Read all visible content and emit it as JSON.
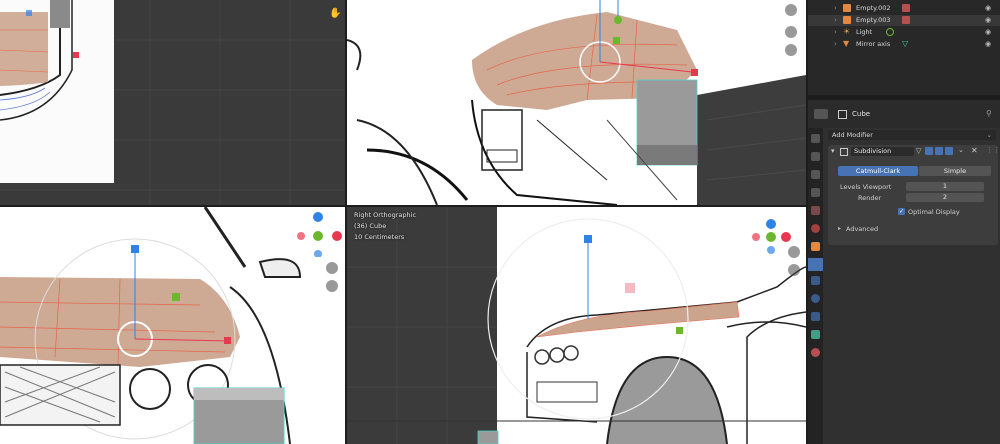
{
  "outliner": {
    "rows": [
      {
        "label": "Empty.002"
      },
      {
        "label": "Empty.003"
      },
      {
        "label": "Light"
      },
      {
        "label": "Mirror axis"
      }
    ]
  },
  "properties": {
    "object_name": "Cube",
    "add_modifier_label": "Add Modifier",
    "modifier": {
      "name": "Subdivision",
      "tab_catmull": "Catmull-Clark",
      "tab_simple": "Simple",
      "levels_viewport_label": "Levels Viewport",
      "levels_viewport_value": "1",
      "render_label": "Render",
      "render_value": "2",
      "optimal_display_label": "Optimal Display",
      "optimal_display_checked": true,
      "advanced_label": "Advanced"
    }
  },
  "viewport_bl_info": {
    "line1": "Right Orthographic",
    "line2": "(36) Cube",
    "line3": "10 Centimeters"
  },
  "colors": {
    "accent_blue": "#4772b3",
    "axis_x": "#e8384f",
    "axis_y": "#6bb82c",
    "axis_z": "#2f83e8",
    "mesh_fill": "#c9a088"
  },
  "icons": [
    "hand-icon",
    "eye-icon",
    "wrench-icon",
    "camera-icon",
    "filter-icon",
    "close-icon",
    "zoom-icon"
  ]
}
